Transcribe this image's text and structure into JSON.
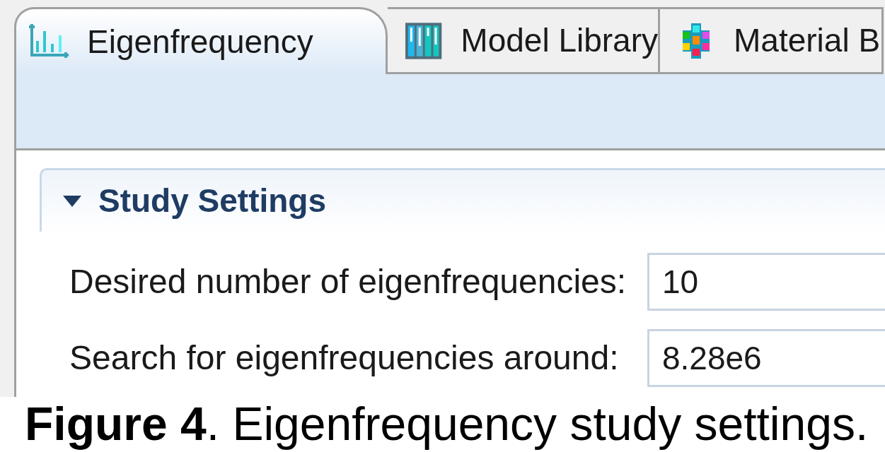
{
  "tabs": [
    {
      "label": "Eigenfrequency",
      "selected": true
    },
    {
      "label": "Model Library",
      "selected": false
    },
    {
      "label": "Material B",
      "selected": false
    }
  ],
  "section": {
    "title": "Study Settings",
    "expanded": true,
    "fields": [
      {
        "label": "Desired number of eigenfrequencies:",
        "value": "10"
      },
      {
        "label": "Search for eigenfrequencies around:",
        "value": "8.28e6"
      }
    ]
  },
  "caption": "**Figure 4**. Eigenfrequency study settings."
}
